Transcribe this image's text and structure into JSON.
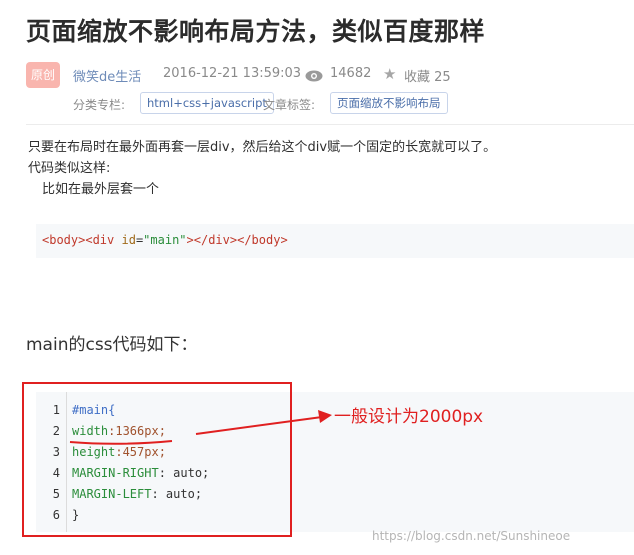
{
  "article": {
    "title": "页面缩放不影响布局方法，类似百度那样",
    "badge": "原创",
    "author": "微笑de生活",
    "date": "2016-12-21 13:59:03",
    "views": "14682",
    "favorites": "收藏 25",
    "category_label": "分类专栏:",
    "category": "html+css+javascript",
    "tags_label": "文章标签:",
    "tag": "页面缩放不影响布局"
  },
  "body": {
    "para1": "只要在布局时在最外面再套一层div，然后给这个div赋一个固定的长宽就可以了。",
    "para2": "代码类似这样:",
    "para3": "比如在最外层套一个",
    "code1": {
      "t1": "<body>",
      "t2": "<div ",
      "attr": "id",
      "eq": "=",
      "val": "\"main\"",
      "t3": "></div></body>"
    },
    "heading2": "main的css代码如下：",
    "code2": {
      "line_numbers": [
        "1",
        "2",
        "3",
        "4",
        "5",
        "6"
      ],
      "lines": [
        {
          "a": "    #main{",
          "b": ""
        },
        {
          "a": "width",
          "b": ":1366px;"
        },
        {
          "a": "height",
          "b": ":457px;"
        },
        {
          "a": "MARGIN-RIGHT",
          "b": ": auto;"
        },
        {
          "a": "MARGIN-LEFT",
          "b": ": auto;"
        },
        {
          "a": "    }",
          "b": ""
        }
      ]
    }
  },
  "annotation": "一般设计为2000px",
  "watermark": "https://blog.csdn.net/Sunshineoe",
  "colors": {
    "accent_red": "#e02020",
    "badge": "#f9b5ae",
    "link": "#4a6ea9"
  },
  "icons": [
    "eye-icon",
    "star-icon"
  ]
}
